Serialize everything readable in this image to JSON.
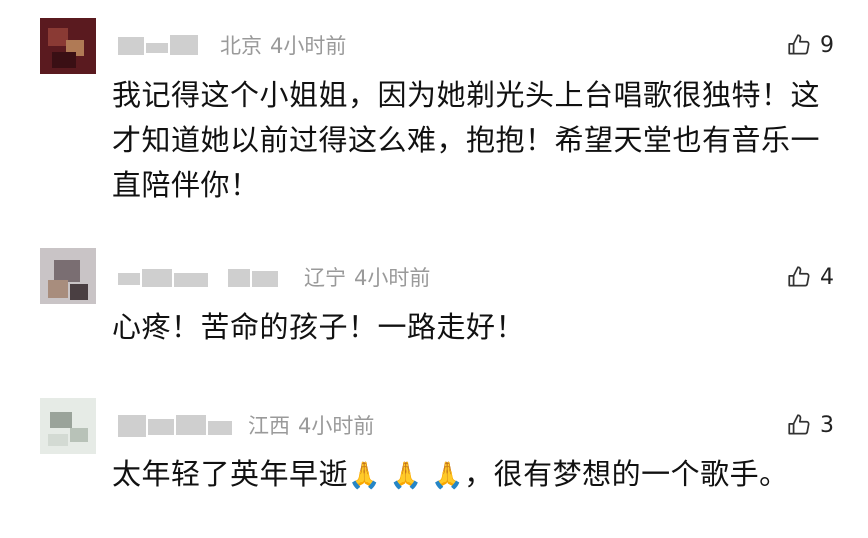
{
  "comments": [
    {
      "location": "北京",
      "time": "4小时前",
      "likes": "9",
      "text": "我记得这个小姐姐，因为她剃光头上台唱歌很独特！这才知道她以前过得这么难，抱抱！希望天堂也有音乐一直陪伴你！"
    },
    {
      "location": "辽宁",
      "time": "4小时前",
      "likes": "4",
      "text": "心疼！苦命的孩子！一路走好！"
    },
    {
      "location": "江西",
      "time": "4小时前",
      "likes": "3",
      "text_before": "太年轻了英年早逝",
      "emoji": "🙏 🙏 🙏",
      "text_after": "，很有梦想的一个歌手。"
    }
  ],
  "icons": {
    "like": "thumbs-up-icon"
  },
  "colors": {
    "meta": "#9a9a9a",
    "text": "#111111"
  }
}
